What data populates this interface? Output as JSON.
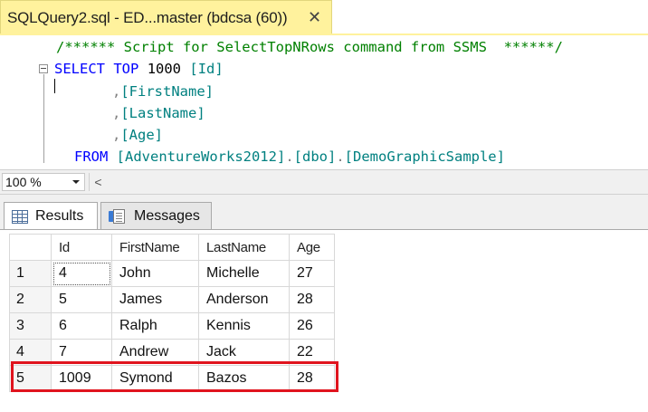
{
  "document_tab": {
    "title": "SQLQuery2.sql - ED...master (bdcsa (60))",
    "close_glyph": "✕"
  },
  "editor": {
    "line1_comment": "/****** Script for SelectTopNRows command from SSMS  ******/",
    "line2": {
      "kw_select": "SELECT",
      "kw_top": "TOP",
      "number": "1000",
      "col": "[Id]"
    },
    "line3": {
      "comma": ",",
      "col": "[FirstName]"
    },
    "line4": {
      "comma": ",",
      "col": "[LastName]"
    },
    "line5": {
      "comma": ",",
      "col": "[Age]"
    },
    "line6": {
      "kw_from": "FROM",
      "db": "[AdventureWorks2012]",
      "dot1": ".",
      "schema": "[dbo]",
      "dot2": ".",
      "table": "[DemoGraphicSample]"
    }
  },
  "zoom": {
    "value": "100 %",
    "scroll_left_glyph": "<"
  },
  "result_tabs": [
    {
      "label": "Results",
      "icon": "grid-icon",
      "active": true
    },
    {
      "label": "Messages",
      "icon": "messages-icon",
      "active": false
    }
  ],
  "grid": {
    "columns": [
      "",
      "Id",
      "FirstName",
      "LastName",
      "Age"
    ],
    "rows": [
      [
        "1",
        "4",
        "John",
        "Michelle",
        "27"
      ],
      [
        "2",
        "5",
        "James",
        "Anderson",
        "28"
      ],
      [
        "3",
        "6",
        "Ralph",
        "Kennis",
        "26"
      ],
      [
        "4",
        "7",
        "Andrew",
        "Jack",
        "22"
      ],
      [
        "5",
        "1009",
        "Symond",
        "Bazos",
        "28"
      ]
    ],
    "highlighted_row": 5
  },
  "colors": {
    "tab_active": "#fff29d",
    "keyword": "#0000ff",
    "identifier": "#008080",
    "comment": "#008000",
    "highlight_border": "#e0141e"
  }
}
